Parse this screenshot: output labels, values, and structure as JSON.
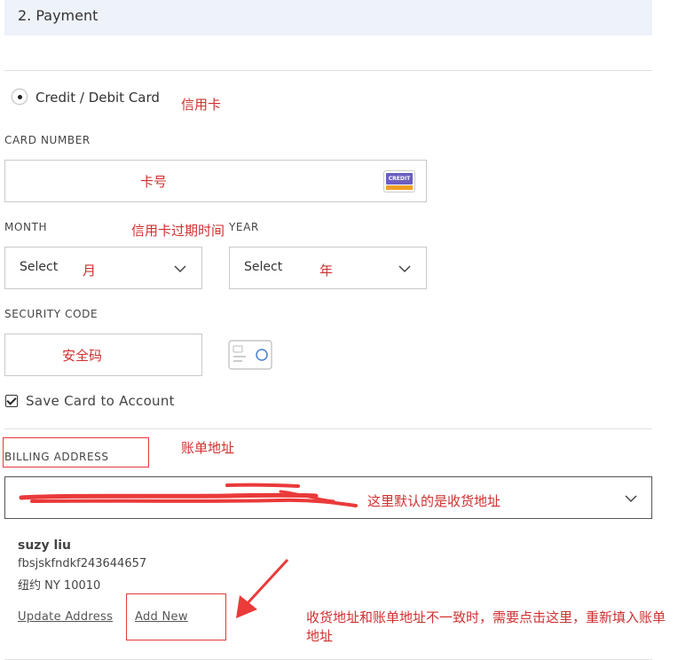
{
  "header": {
    "title": "2. Payment"
  },
  "payment_method": {
    "label": "Credit / Debit Card",
    "note": "信用卡"
  },
  "card_number": {
    "label": "CARD NUMBER",
    "note": "卡号",
    "card_icon_text": "CREDIT"
  },
  "expiry": {
    "month_label": "MONTH",
    "year_label": "YEAR",
    "note": "信用卡过期时间",
    "month_value": "Select",
    "month_note": "月",
    "year_value": "Select",
    "year_note": "年"
  },
  "security": {
    "label": "SECURITY CODE",
    "note": "安全码"
  },
  "save_card": {
    "label": "Save Card to Account"
  },
  "billing": {
    "label": "BILLING ADDRESS",
    "note": "账单地址",
    "select_note": "这里默认的是收货地址"
  },
  "address": {
    "name": "suzy liu",
    "line1": "fbsjskfndkf243644657",
    "line2": "纽约 NY 10010"
  },
  "actions": {
    "update_label": "Update Address",
    "add_new_label": "Add New",
    "note": "收货地址和账单地址不一致时，需要点击这里，重新填入账单地址"
  },
  "colors": {
    "annotation": "#d03030",
    "header_bg": "#eef2f9",
    "card_top": "#6a5fc1",
    "card_bottom": "#f0a020"
  }
}
